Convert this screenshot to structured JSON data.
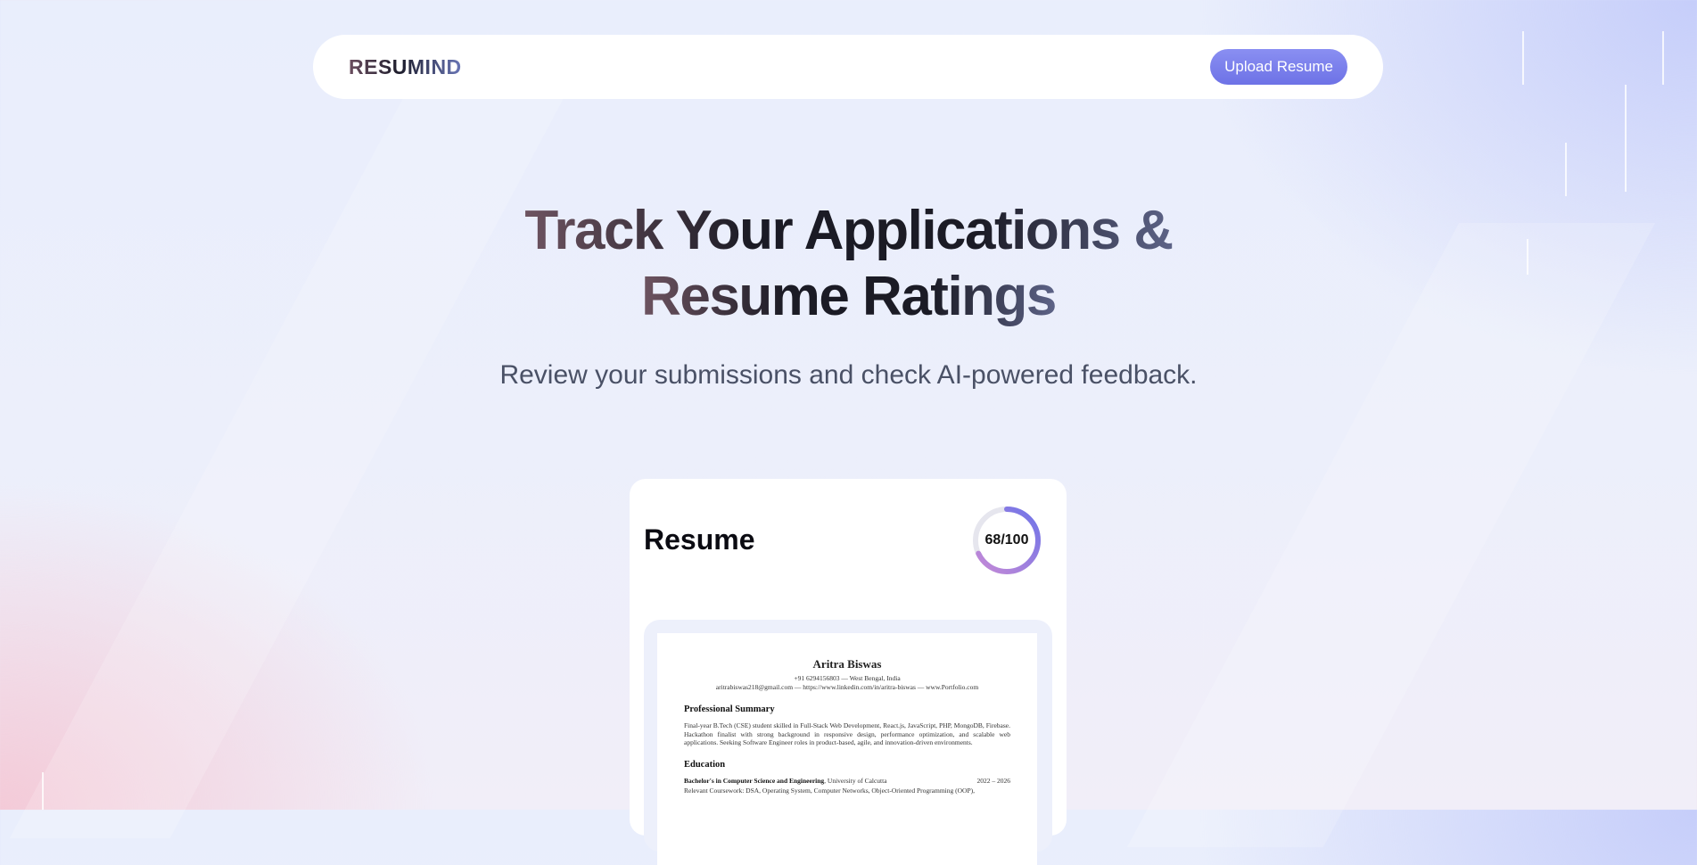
{
  "navbar": {
    "logo": "RESUMIND",
    "upload_button": "Upload Resume"
  },
  "hero": {
    "title_line1": "Track Your Applications &",
    "title_line2": "Resume Ratings",
    "subtitle": "Review your submissions and check AI-powered feedback."
  },
  "resume_card": {
    "title": "Resume",
    "score_label": "68/100",
    "score_value": 68,
    "score_max": 100,
    "preview": {
      "name": "Aritra Biswas",
      "contact_line1": "+91 6294156803 — West Bengal, India",
      "contact_line2": "aritrabiswas218@gmail.com — https://www.linkedin.com/in/aritra-biswas — www.Portfolio.com",
      "summary_heading": "Professional Summary",
      "summary_text": "Final-year B.Tech (CSE) student skilled in Full-Stack Web Development, React.js, JavaScript, PHP, MongoDB, Firebase. Hackathon finalist with strong background in responsive design, performance optimization, and scalable web applications. Seeking Software Engineer roles in product-based, agile, and innovation-driven environments.",
      "education_heading": "Education",
      "degree": "Bachelor's in Computer Science and Engineering",
      "institution": ", University of Calcutta",
      "years": "2022 – 2026",
      "coursework": "Relevant Coursework: DSA, Operating System, Computer Networks, Object-Oriented Programming (OOP),"
    }
  },
  "colors": {
    "accent": "#7a7ff0",
    "score_ring_start": "#c78ad6",
    "score_ring_end": "#6f74e8"
  }
}
